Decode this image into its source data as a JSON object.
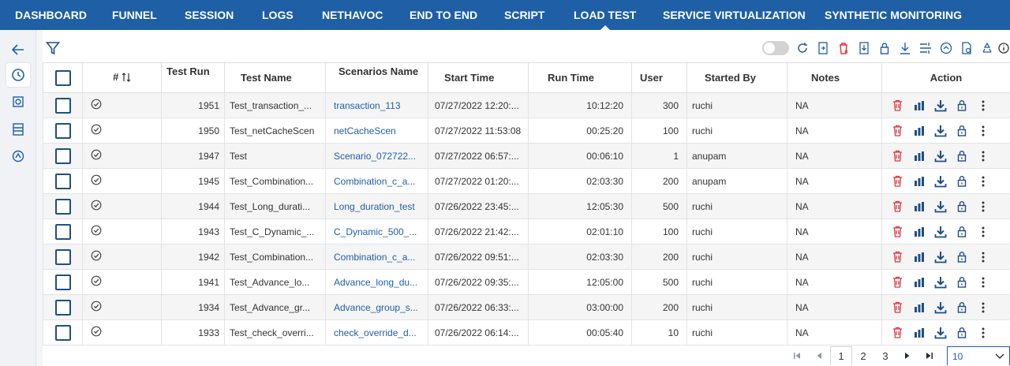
{
  "nav": {
    "items": [
      "DASHBOARD",
      "FUNNEL",
      "SESSION",
      "LOGS",
      "NETHAVOC",
      "END TO END",
      "SCRIPT",
      "LOAD TEST",
      "SERVICE VIRTUALIZATION",
      "SYNTHETIC MONITORING"
    ],
    "active": "LOAD TEST"
  },
  "table": {
    "headers": {
      "index": "#",
      "test_run": "Test Run",
      "test_name": "Test Name",
      "scenarios_name": "Scenarios Name",
      "start_time": "Start Time",
      "run_time": "Run Time",
      "user": "User",
      "started_by": "Started By",
      "notes": "Notes",
      "action": "Action"
    },
    "rows": [
      {
        "test_run": "1951",
        "test_name": "Test_transaction_...",
        "scenario": "transaction_113",
        "start_time": "07/27/2022 12:20:...",
        "run_time": "10:12:20",
        "user": "300",
        "started_by": "ruchi",
        "notes": "NA"
      },
      {
        "test_run": "1950",
        "test_name": "Test_netCacheScen",
        "scenario": "netCacheScen",
        "start_time": "07/27/2022 11:53:08",
        "run_time": "00:25:20",
        "user": "100",
        "started_by": "ruchi",
        "notes": "NA"
      },
      {
        "test_run": "1947",
        "test_name": "Test",
        "scenario": "Scenario_072722...",
        "start_time": "07/27/2022 06:57:...",
        "run_time": "00:06:10",
        "user": "1",
        "started_by": "anupam",
        "notes": "NA"
      },
      {
        "test_run": "1945",
        "test_name": "Test_Combination...",
        "scenario": "Combination_c_a...",
        "start_time": "07/27/2022 01:20:...",
        "run_time": "02:03:30",
        "user": "200",
        "started_by": "anupam",
        "notes": "NA"
      },
      {
        "test_run": "1944",
        "test_name": "Test_Long_durati...",
        "scenario": "Long_duration_test",
        "start_time": "07/26/2022 23:45:...",
        "run_time": "12:05:30",
        "user": "500",
        "started_by": "ruchi",
        "notes": "NA"
      },
      {
        "test_run": "1943",
        "test_name": "Test_C_Dynamic_...",
        "scenario": "C_Dynamic_500_...",
        "start_time": "07/26/2022 21:42:...",
        "run_time": "02:01:10",
        "user": "100",
        "started_by": "ruchi",
        "notes": "NA"
      },
      {
        "test_run": "1942",
        "test_name": "Test_Combination...",
        "scenario": "Combination_c_a...",
        "start_time": "07/26/2022 09:51:...",
        "run_time": "02:03:30",
        "user": "200",
        "started_by": "ruchi",
        "notes": "NA"
      },
      {
        "test_run": "1941",
        "test_name": "Test_Advance_lo...",
        "scenario": "Advance_long_du...",
        "start_time": "07/26/2022 09:35:...",
        "run_time": "12:05:00",
        "user": "500",
        "started_by": "ruchi",
        "notes": "NA"
      },
      {
        "test_run": "1934",
        "test_name": "Test_Advance_gr...",
        "scenario": "Advance_group_s...",
        "start_time": "07/26/2022 06:33:...",
        "run_time": "03:00:00",
        "user": "200",
        "started_by": "ruchi",
        "notes": "NA"
      },
      {
        "test_run": "1933",
        "test_name": "Test_check_overri...",
        "scenario": "check_override_d...",
        "start_time": "07/26/2022 06:14:...",
        "run_time": "00:05:40",
        "user": "10",
        "started_by": "ruchi",
        "notes": "NA"
      }
    ]
  },
  "pager": {
    "pages": [
      "1",
      "2",
      "3"
    ],
    "current": "1",
    "page_size": "10"
  },
  "colors": {
    "brand": "#1f5fa6",
    "delete": "#e0363a"
  }
}
